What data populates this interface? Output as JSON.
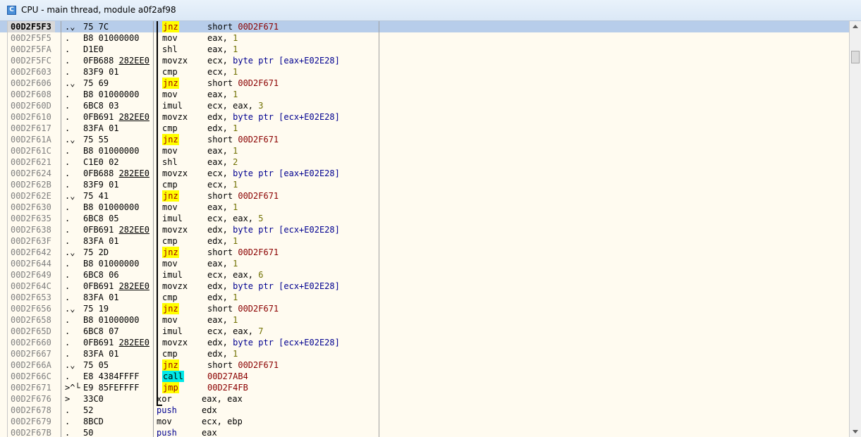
{
  "window": {
    "title": "CPU - main thread, module a0f2af98",
    "icon": "cpu-window-icon"
  },
  "rows": [
    {
      "addr": "00D2F5F3",
      "flag": ".⌄",
      "hex": "75 7C",
      "hexu": "",
      "mn": "jnz",
      "mnStyle": "jump",
      "op": [
        [
          "short ",
          "plain"
        ],
        [
          "00D2F671",
          "tgt"
        ]
      ],
      "selected": true
    },
    {
      "addr": "00D2F5F5",
      "flag": ".",
      "hex": "B8 01000000",
      "hexu": "",
      "mn": "mov",
      "op": [
        [
          "eax, ",
          "plain"
        ],
        [
          "1",
          "imm"
        ]
      ]
    },
    {
      "addr": "00D2F5FA",
      "flag": ".",
      "hex": "D1E0",
      "hexu": "",
      "mn": "shl",
      "op": [
        [
          "eax, ",
          "plain"
        ],
        [
          "1",
          "imm"
        ]
      ]
    },
    {
      "addr": "00D2F5FC",
      "flag": ".",
      "hex": "0FB688 ",
      "hexu": "282EE0",
      "mn": "movzx",
      "op": [
        [
          "ecx, ",
          "plain"
        ],
        [
          "byte ptr [eax+E02E28]",
          "kw"
        ]
      ]
    },
    {
      "addr": "00D2F603",
      "flag": ".",
      "hex": "83F9 01",
      "hexu": "",
      "mn": "cmp",
      "op": [
        [
          "ecx, ",
          "plain"
        ],
        [
          "1",
          "imm"
        ]
      ]
    },
    {
      "addr": "00D2F606",
      "flag": ".⌄",
      "hex": "75 69",
      "hexu": "",
      "mn": "jnz",
      "mnStyle": "jump",
      "op": [
        [
          "short ",
          "plain"
        ],
        [
          "00D2F671",
          "tgt"
        ]
      ]
    },
    {
      "addr": "00D2F608",
      "flag": ".",
      "hex": "B8 01000000",
      "hexu": "",
      "mn": "mov",
      "op": [
        [
          "eax, ",
          "plain"
        ],
        [
          "1",
          "imm"
        ]
      ]
    },
    {
      "addr": "00D2F60D",
      "flag": ".",
      "hex": "6BC8 03",
      "hexu": "",
      "mn": "imul",
      "op": [
        [
          "ecx, eax, ",
          "plain"
        ],
        [
          "3",
          "imm"
        ]
      ]
    },
    {
      "addr": "00D2F610",
      "flag": ".",
      "hex": "0FB691 ",
      "hexu": "282EE0",
      "mn": "movzx",
      "op": [
        [
          "edx, ",
          "plain"
        ],
        [
          "byte ptr [ecx+E02E28]",
          "kw"
        ]
      ]
    },
    {
      "addr": "00D2F617",
      "flag": ".",
      "hex": "83FA 01",
      "hexu": "",
      "mn": "cmp",
      "op": [
        [
          "edx, ",
          "plain"
        ],
        [
          "1",
          "imm"
        ]
      ]
    },
    {
      "addr": "00D2F61A",
      "flag": ".⌄",
      "hex": "75 55",
      "hexu": "",
      "mn": "jnz",
      "mnStyle": "jump",
      "op": [
        [
          "short ",
          "plain"
        ],
        [
          "00D2F671",
          "tgt"
        ]
      ]
    },
    {
      "addr": "00D2F61C",
      "flag": ".",
      "hex": "B8 01000000",
      "hexu": "",
      "mn": "mov",
      "op": [
        [
          "eax, ",
          "plain"
        ],
        [
          "1",
          "imm"
        ]
      ]
    },
    {
      "addr": "00D2F621",
      "flag": ".",
      "hex": "C1E0 02",
      "hexu": "",
      "mn": "shl",
      "op": [
        [
          "eax, ",
          "plain"
        ],
        [
          "2",
          "imm"
        ]
      ]
    },
    {
      "addr": "00D2F624",
      "flag": ".",
      "hex": "0FB688 ",
      "hexu": "282EE0",
      "mn": "movzx",
      "op": [
        [
          "ecx, ",
          "plain"
        ],
        [
          "byte ptr [eax+E02E28]",
          "kw"
        ]
      ]
    },
    {
      "addr": "00D2F62B",
      "flag": ".",
      "hex": "83F9 01",
      "hexu": "",
      "mn": "cmp",
      "op": [
        [
          "ecx, ",
          "plain"
        ],
        [
          "1",
          "imm"
        ]
      ]
    },
    {
      "addr": "00D2F62E",
      "flag": ".⌄",
      "hex": "75 41",
      "hexu": "",
      "mn": "jnz",
      "mnStyle": "jump",
      "op": [
        [
          "short ",
          "plain"
        ],
        [
          "00D2F671",
          "tgt"
        ]
      ]
    },
    {
      "addr": "00D2F630",
      "flag": ".",
      "hex": "B8 01000000",
      "hexu": "",
      "mn": "mov",
      "op": [
        [
          "eax, ",
          "plain"
        ],
        [
          "1",
          "imm"
        ]
      ]
    },
    {
      "addr": "00D2F635",
      "flag": ".",
      "hex": "6BC8 05",
      "hexu": "",
      "mn": "imul",
      "op": [
        [
          "ecx, eax, ",
          "plain"
        ],
        [
          "5",
          "imm"
        ]
      ]
    },
    {
      "addr": "00D2F638",
      "flag": ".",
      "hex": "0FB691 ",
      "hexu": "282EE0",
      "mn": "movzx",
      "op": [
        [
          "edx, ",
          "plain"
        ],
        [
          "byte ptr [ecx+E02E28]",
          "kw"
        ]
      ]
    },
    {
      "addr": "00D2F63F",
      "flag": ".",
      "hex": "83FA 01",
      "hexu": "",
      "mn": "cmp",
      "op": [
        [
          "edx, ",
          "plain"
        ],
        [
          "1",
          "imm"
        ]
      ]
    },
    {
      "addr": "00D2F642",
      "flag": ".⌄",
      "hex": "75 2D",
      "hexu": "",
      "mn": "jnz",
      "mnStyle": "jump",
      "op": [
        [
          "short ",
          "plain"
        ],
        [
          "00D2F671",
          "tgt"
        ]
      ]
    },
    {
      "addr": "00D2F644",
      "flag": ".",
      "hex": "B8 01000000",
      "hexu": "",
      "mn": "mov",
      "op": [
        [
          "eax, ",
          "plain"
        ],
        [
          "1",
          "imm"
        ]
      ]
    },
    {
      "addr": "00D2F649",
      "flag": ".",
      "hex": "6BC8 06",
      "hexu": "",
      "mn": "imul",
      "op": [
        [
          "ecx, eax, ",
          "plain"
        ],
        [
          "6",
          "imm"
        ]
      ]
    },
    {
      "addr": "00D2F64C",
      "flag": ".",
      "hex": "0FB691 ",
      "hexu": "282EE0",
      "mn": "movzx",
      "op": [
        [
          "edx, ",
          "plain"
        ],
        [
          "byte ptr [ecx+E02E28]",
          "kw"
        ]
      ]
    },
    {
      "addr": "00D2F653",
      "flag": ".",
      "hex": "83FA 01",
      "hexu": "",
      "mn": "cmp",
      "op": [
        [
          "edx, ",
          "plain"
        ],
        [
          "1",
          "imm"
        ]
      ]
    },
    {
      "addr": "00D2F656",
      "flag": ".⌄",
      "hex": "75 19",
      "hexu": "",
      "mn": "jnz",
      "mnStyle": "jump",
      "op": [
        [
          "short ",
          "plain"
        ],
        [
          "00D2F671",
          "tgt"
        ]
      ]
    },
    {
      "addr": "00D2F658",
      "flag": ".",
      "hex": "B8 01000000",
      "hexu": "",
      "mn": "mov",
      "op": [
        [
          "eax, ",
          "plain"
        ],
        [
          "1",
          "imm"
        ]
      ]
    },
    {
      "addr": "00D2F65D",
      "flag": ".",
      "hex": "6BC8 07",
      "hexu": "",
      "mn": "imul",
      "op": [
        [
          "ecx, eax, ",
          "plain"
        ],
        [
          "7",
          "imm"
        ]
      ]
    },
    {
      "addr": "00D2F660",
      "flag": ".",
      "hex": "0FB691 ",
      "hexu": "282EE0",
      "mn": "movzx",
      "op": [
        [
          "edx, ",
          "plain"
        ],
        [
          "byte ptr [ecx+E02E28]",
          "kw"
        ]
      ]
    },
    {
      "addr": "00D2F667",
      "flag": ".",
      "hex": "83FA 01",
      "hexu": "",
      "mn": "cmp",
      "op": [
        [
          "edx, ",
          "plain"
        ],
        [
          "1",
          "imm"
        ]
      ]
    },
    {
      "addr": "00D2F66A",
      "flag": ".⌄",
      "hex": "75 05",
      "hexu": "",
      "mn": "jnz",
      "mnStyle": "jump",
      "op": [
        [
          "short ",
          "plain"
        ],
        [
          "00D2F671",
          "tgt"
        ]
      ]
    },
    {
      "addr": "00D2F66C",
      "flag": ".",
      "hex": "E8 4384FFFF",
      "hexu": "",
      "mn": "call",
      "mnStyle": "call",
      "op": [
        [
          "00D27AB4",
          "tgt"
        ]
      ]
    },
    {
      "addr": "00D2F671",
      "flag": ">^└",
      "hex": "E9 85FEFFFF",
      "hexu": "",
      "mn": "jmp",
      "mnStyle": "jump",
      "op": [
        [
          "00D2F4FB",
          "tgt"
        ]
      ]
    },
    {
      "addr": "00D2F676",
      "flag": ">",
      "hex": "33C0",
      "hexu": "",
      "mn": "xor",
      "mnShift": true,
      "op": [
        [
          "eax, eax",
          "plain"
        ]
      ]
    },
    {
      "addr": "00D2F678",
      "flag": ".",
      "hex": "52",
      "hexu": "",
      "mn": "push",
      "mnStyle": "kw",
      "mnShift": true,
      "op": [
        [
          "edx",
          "plain"
        ]
      ]
    },
    {
      "addr": "00D2F679",
      "flag": ".",
      "hex": "8BCD",
      "hexu": "",
      "mn": "mov",
      "mnShift": true,
      "op": [
        [
          "ecx, ebp",
          "plain"
        ]
      ]
    },
    {
      "addr": "00D2F67B",
      "flag": ".",
      "hex": "50",
      "hexu": "",
      "mn": "push",
      "mnStyle": "kw",
      "mnShift": true,
      "op": [
        [
          "eax",
          "plain"
        ]
      ]
    }
  ]
}
